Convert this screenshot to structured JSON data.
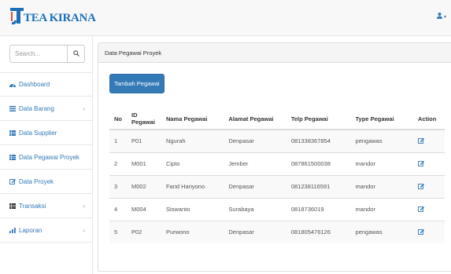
{
  "brand": {
    "name": "TEA KIRANA",
    "logo_letter": "J",
    "accent": "#1d6fb8"
  },
  "navbar": {
    "user_icon": "user-icon",
    "caret": "▾"
  },
  "sidebar": {
    "search": {
      "placeholder": "Search...",
      "icon": "search-icon"
    },
    "items": [
      {
        "label": "Dashboard",
        "icon": "dashboard-icon",
        "has_arrow": false
      },
      {
        "label": "Data Barang",
        "icon": "list-icon",
        "has_arrow": true
      },
      {
        "label": "Data Supplier",
        "icon": "table-icon",
        "has_arrow": false
      },
      {
        "label": "Data Pegawai Proyek",
        "icon": "table-icon",
        "has_arrow": false
      },
      {
        "label": "Data Proyek",
        "icon": "edit-icon",
        "has_arrow": false
      },
      {
        "label": "Transaksi",
        "icon": "book-icon",
        "has_arrow": true
      },
      {
        "label": "Laporan",
        "icon": "bar-chart-icon",
        "has_arrow": true
      }
    ],
    "arrow": "‹"
  },
  "panel": {
    "heading": "Data Pegawai Proyek",
    "add_button": "Tambah Pegawai"
  },
  "table": {
    "headers": [
      "No",
      "ID Pegawai",
      "Nama Pegawai",
      "Alamat Pegawai",
      "Telp Pegawai",
      "Type Pegawai",
      "Action"
    ],
    "rows": [
      {
        "no": "1",
        "id": "P01",
        "nama": "Ngurah",
        "alamat": "Denpasar",
        "telp": "081338367854",
        "type": "pengawas"
      },
      {
        "no": "2",
        "id": "M001",
        "nama": "Cipto",
        "alamat": "Jember",
        "telp": "087861500038",
        "type": "mandor"
      },
      {
        "no": "3",
        "id": "M002",
        "nama": "Farid Hariyono",
        "alamat": "Denpasar",
        "telp": "081238116591",
        "type": "mandor"
      },
      {
        "no": "4",
        "id": "M004",
        "nama": "Siswanto",
        "alamat": "Surabaya",
        "telp": "0818736019",
        "type": "mandor"
      },
      {
        "no": "5",
        "id": "P02",
        "nama": "Purwono",
        "alamat": "Denpasar",
        "telp": "081805476126",
        "type": "pengawas"
      }
    ],
    "action_icon": "edit-icon"
  }
}
